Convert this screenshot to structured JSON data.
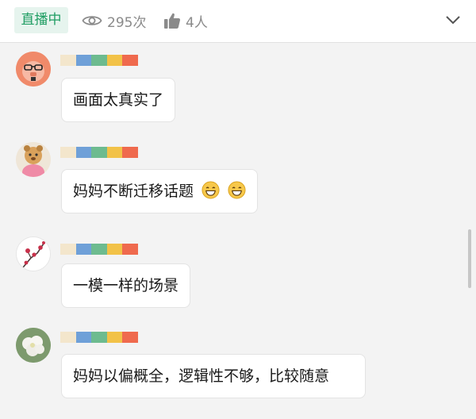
{
  "header": {
    "live_label": "直播中",
    "views": "295次",
    "likes": "4人"
  },
  "comments": [
    {
      "text": "画面太真实了"
    },
    {
      "text": "妈妈不断迁移话题"
    },
    {
      "text": "一模一样的场景"
    },
    {
      "text": "妈妈以偏概全，逻辑性不够，比较随意"
    }
  ],
  "colors": {
    "accent": "#1f9d63",
    "name_bar": [
      "#f3e6cc",
      "#6fa0d8",
      "#6dbb8f",
      "#f2c248",
      "#ef6a4e"
    ]
  },
  "icons": [
    "eye-icon",
    "thumbs-up-icon",
    "chevron-down-icon",
    "grin-emoji-icon"
  ]
}
